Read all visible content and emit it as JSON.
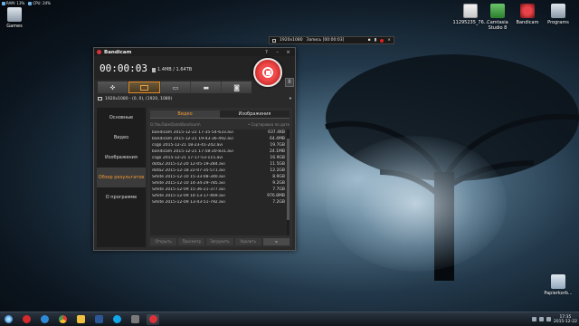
{
  "desktop": {
    "gauges": {
      "ram": "RAM: 13%",
      "cpu": "CPU: 24%"
    },
    "icons": [
      {
        "label": "Games"
      },
      {
        "label": "11295235_76..."
      },
      {
        "label": "Camtasia Studio 8"
      },
      {
        "label": "Bandicam"
      },
      {
        "label": "Programs"
      },
      {
        "label": "Papierkorb..."
      }
    ]
  },
  "recbar": {
    "resolution": "1920x1080",
    "status": "Запись [00:00:03]"
  },
  "window": {
    "title": "Bandicam",
    "help": "?",
    "minimize": "–",
    "close": "×",
    "timer": "00:00:03",
    "size": "1.4MB / 1.64TB",
    "pause": "II",
    "resolution": "1920x1080 - (0, 0), (1920, 1080)",
    "sidebar": [
      "Основные",
      "Видео",
      "Изображения",
      "Обзор результатов",
      "О программе"
    ],
    "tabs": [
      "Видео",
      "Изображения"
    ],
    "path": "G:\\YouTube\\Data\\Bandicam\\",
    "sort": "• Сортировка по дате",
    "files": [
      {
        "name": "bandicam 2015-12-22 17-35-54-633.avi",
        "size": "637.4KB"
      },
      {
        "name": "bandicam 2015-12-21 19-43-36-492.avi",
        "size": "64.4MB"
      },
      {
        "name": "csgo 2015-12-21 18-23-41-242.avi",
        "size": "19.7GB"
      },
      {
        "name": "bandicam 2015-12-21 17-58-20-831.avi",
        "size": "24.1MB"
      },
      {
        "name": "csgo 2015-12-21 17-17-53-115.avi",
        "size": "16.9GB"
      },
      {
        "name": "dota2 2015-12-20 12-05-19-284.avi",
        "size": "11.5GB"
      },
      {
        "name": "dota2 2015-12-18 22-07-35-571.avi",
        "size": "12.2GB"
      },
      {
        "name": "Smite 2015-12-10 15-33-08-340.avi",
        "size": "8.9GB"
      },
      {
        "name": "Smite 2015-12-10 14-34-29-785.avi",
        "size": "9.2GB"
      },
      {
        "name": "Smite 2015-12-09 15-36-21-377.avi",
        "size": "7.7GB"
      },
      {
        "name": "Smite 2015-12-09 14-13-17-469.avi",
        "size": "976.8MB"
      },
      {
        "name": "Smite 2015-12-09 13-43-51-792.avi",
        "size": "7.2GB"
      }
    ],
    "actions": [
      "Открыть",
      "Просмотр",
      "Загрузить",
      "Удалить"
    ]
  },
  "taskbar": {
    "clock_time": "17:35",
    "clock_date": "2015-12-22"
  }
}
